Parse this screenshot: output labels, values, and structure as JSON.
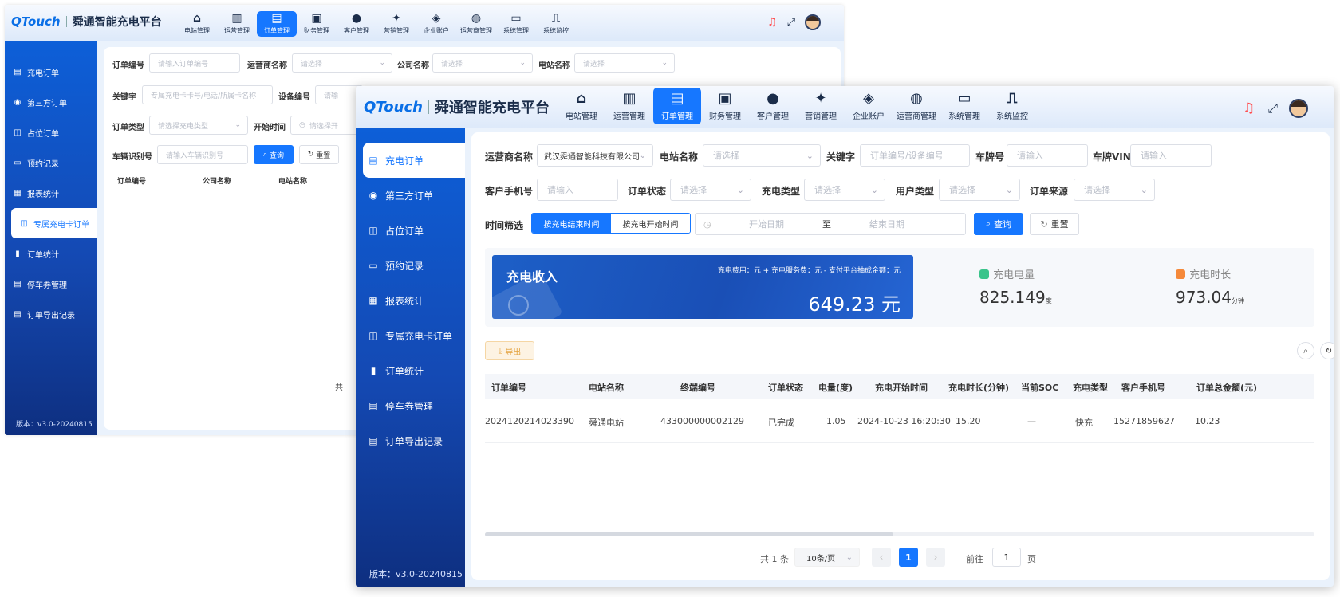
{
  "brand": {
    "logo": "QTouch",
    "title": "舜通智能充电平台"
  },
  "nav": [
    {
      "icon": "home-icon",
      "glyph": "⌂",
      "label": "电站管理"
    },
    {
      "icon": "bar-chart-icon",
      "glyph": "▥",
      "label": "运营管理"
    },
    {
      "icon": "order-icon",
      "glyph": "▤",
      "label": "订单管理",
      "active": true
    },
    {
      "icon": "wallet-icon",
      "glyph": "▣",
      "label": "财务管理"
    },
    {
      "icon": "user-icon",
      "glyph": "●",
      "label": "客户管理"
    },
    {
      "icon": "marketing-icon",
      "glyph": "✦",
      "label": "营销管理"
    },
    {
      "icon": "enterprise-icon",
      "glyph": "◈",
      "label": "企业账户"
    },
    {
      "icon": "operator-icon",
      "glyph": "◍",
      "label": "运营商管理"
    },
    {
      "icon": "system-icon",
      "glyph": "▭",
      "label": "系统管理"
    },
    {
      "icon": "monitor-icon",
      "glyph": "⎍",
      "label": "系统监控"
    }
  ],
  "topright": {
    "bell": "bell-icon",
    "fullscreen": "fullscreen-icon",
    "avatar": "avatar"
  },
  "sidebar": [
    {
      "icon": "charge-order-icon",
      "glyph": "▤",
      "label": "充电订单"
    },
    {
      "icon": "third-party-icon",
      "glyph": "◉",
      "label": "第三方订单"
    },
    {
      "icon": "occupy-icon",
      "glyph": "◫",
      "label": "占位订单"
    },
    {
      "icon": "reserve-icon",
      "glyph": "▭",
      "label": "预约记录"
    },
    {
      "icon": "report-icon",
      "glyph": "▦",
      "label": "报表统计"
    },
    {
      "icon": "card-icon",
      "glyph": "◫",
      "label": "专属充电卡订单"
    },
    {
      "icon": "stats-icon",
      "glyph": "▮",
      "label": "订单统计"
    },
    {
      "icon": "ticket-icon",
      "glyph": "▤",
      "label": "停车券管理"
    },
    {
      "icon": "export-log-icon",
      "glyph": "▤",
      "label": "订单导出记录"
    }
  ],
  "version": "版本：v3.0-20240815",
  "back": {
    "active_sidebar": 5,
    "filters": [
      {
        "label": "订单编号",
        "placeholder": "请输入订单编号"
      },
      {
        "label": "运营商名称",
        "placeholder": "请选择"
      },
      {
        "label": "公司名称",
        "placeholder": "请选择"
      },
      {
        "label": "电站名称",
        "placeholder": "请选择"
      },
      {
        "label": "关键字",
        "placeholder": "专属充电卡卡号/电话/所属卡名称"
      },
      {
        "label": "设备编号",
        "placeholder": "请输"
      },
      {
        "label": "订单类型",
        "placeholder": "请选择充电类型"
      },
      {
        "label": "开始时间",
        "placeholder": "请选择开"
      },
      {
        "label": "车辆识别号",
        "placeholder": "请输入车辆识别号"
      }
    ],
    "query": "查询",
    "reset": "重置",
    "columns": [
      "订单编号",
      "公司名称",
      "电站名称"
    ],
    "fragment": "共"
  },
  "front": {
    "active_sidebar": 0,
    "filters": {
      "operator": {
        "label": "运营商名称",
        "value": "武汉舜通智能科技有限公司"
      },
      "station": {
        "label": "电站名称",
        "placeholder": "请选择"
      },
      "keyword": {
        "label": "关键字",
        "placeholder": "订单编号/设备编号"
      },
      "plate": {
        "label": "车牌号",
        "placeholder": "请输入"
      },
      "vin": {
        "label": "车牌VIN",
        "placeholder": "请输入"
      },
      "phone": {
        "label": "客户手机号",
        "placeholder": "请输入"
      },
      "status": {
        "label": "订单状态",
        "placeholder": "请选择"
      },
      "ctype": {
        "label": "充电类型",
        "placeholder": "请选择"
      },
      "utype": {
        "label": "用户类型",
        "placeholder": "请选择"
      },
      "source": {
        "label": "订单来源",
        "placeholder": "请选择"
      },
      "time": {
        "label": "时间筛选",
        "opt1": "按充电结束时间",
        "opt2": "按充电开始时间",
        "start": "开始日期",
        "sep": "至",
        "end": "结束日期"
      }
    },
    "query": "查询",
    "reset": "重置",
    "income": {
      "title": "充电收入",
      "formula": "充电费用：元 + 充电服务费：元 - 支付平台抽成金额：元",
      "value": "649.23 元"
    },
    "energy": {
      "label": "充电电量",
      "value": "825.149",
      "unit": "度"
    },
    "duration": {
      "label": "充电时长",
      "value": "973.04",
      "unit": "分钟"
    },
    "export": "导出",
    "columns": [
      "订单编号",
      "电站名称",
      "终端编号",
      "订单状态",
      "电量(度)",
      "充电开始时间",
      "充电时长(分钟)",
      "当前SOC",
      "充电类型",
      "客户手机号",
      "订单总金额(元)"
    ],
    "rows": [
      [
        "2024120214023390",
        "舜通电站",
        "433000000002129",
        "已完成",
        "1.05",
        "2024-10-23 16:20:30",
        "15.20",
        "—",
        "快充",
        "15271859627",
        "10.23"
      ]
    ],
    "pagination": {
      "total": "共 1 条",
      "size": "10条/页",
      "page": "1",
      "goto": "前往",
      "goto_val": "1",
      "page_unit": "页"
    }
  }
}
